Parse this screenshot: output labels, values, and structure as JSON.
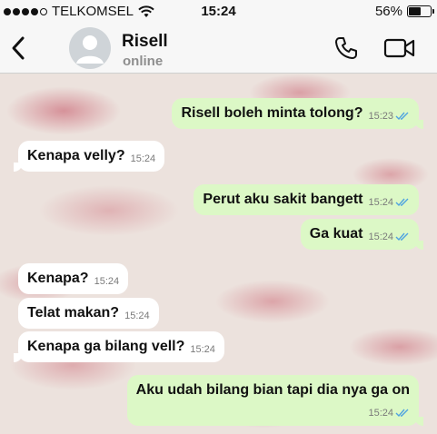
{
  "status_bar": {
    "carrier": "TELKOMSEL",
    "time": "15:24",
    "battery": "56%",
    "battery_level": 0.56
  },
  "header": {
    "contact_name": "Risell",
    "contact_status": "online"
  },
  "messages": [
    {
      "direction": "out",
      "text": "Risell boleh minta tolong?",
      "time": "15:23",
      "read": true
    },
    {
      "direction": "in",
      "text": "Kenapa velly?",
      "time": "15:24"
    },
    {
      "direction": "out",
      "text": "Perut aku sakit bangett",
      "time": "15:24",
      "read": true
    },
    {
      "direction": "out",
      "text": "Ga kuat",
      "time": "15:24",
      "read": true
    },
    {
      "direction": "in",
      "text": "Kenapa?",
      "time": "15:24"
    },
    {
      "direction": "in",
      "text": "Telat makan?",
      "time": "15:24"
    },
    {
      "direction": "in",
      "text": "Kenapa ga bilang vell?",
      "time": "15:24"
    },
    {
      "direction": "out",
      "text": "Aku udah bilang bian tapi dia nya ga on",
      "time": "15:24",
      "read": true
    }
  ],
  "colors": {
    "outgoing_bubble": "#dcf8c6",
    "incoming_bubble": "#ffffff",
    "read_ticks": "#4fa3e0"
  }
}
